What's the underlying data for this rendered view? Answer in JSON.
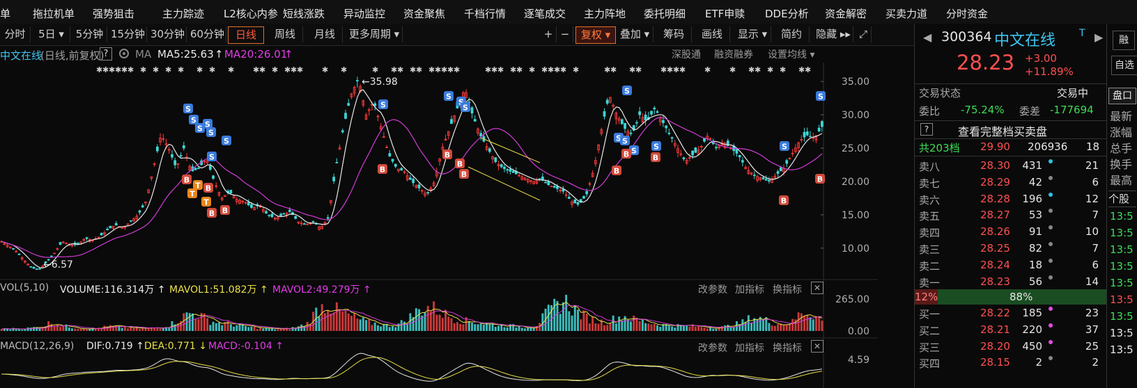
{
  "menu": [
    "单",
    "拖拉机单",
    "强势狙击",
    "主力踪迹",
    "L2核心内参",
    "短线涨跌",
    "异动监控",
    "资金聚焦",
    "千档行情",
    "逐笔成交",
    "主力阵地",
    "委托明细",
    "ETF申赎",
    "DDE分析",
    "资金解密",
    "买卖力道",
    "分时资金"
  ],
  "periods": [
    "分时",
    "5日 ▾",
    "5分钟",
    "15分钟",
    "30分钟",
    "60分钟",
    "日线",
    "周线",
    "月线",
    "更多周期 ▾"
  ],
  "tools": [
    "+",
    "−",
    "复权 ▾",
    "叠加 ▾",
    "筹码",
    "画线",
    "显示 ▾",
    "简约",
    "隐藏 ▸▸"
  ],
  "info": {
    "name": "中文在线",
    "mode": "(日线,前复权)",
    "help": "?",
    "ma_label": "MA",
    "ma5": "MA5:25.63",
    "ma20": "MA20:26.01",
    "links": [
      "深股通",
      "融资融券",
      "设置均线 ▾"
    ]
  },
  "chart_data": [
    {
      "type": "candlestick",
      "title": "中文在线 (日线,前复权)",
      "y_ticks": [
        "35.00",
        "30.00",
        "25.00",
        "20.00",
        "15.00",
        "10.00"
      ],
      "ylim": [
        5.5,
        37
      ],
      "annotations": [
        "←35.98",
        "←6.57"
      ],
      "series": [
        {
          "name": "MA5",
          "value": "25.63"
        },
        {
          "name": "MA20",
          "value": "26.01"
        }
      ],
      "close_path": [
        11,
        10.3,
        9.5,
        8.2,
        7.0,
        6.8,
        8.0,
        9.3,
        11.0,
        10.5,
        10.5,
        11.5,
        11.2,
        11.8,
        12.8,
        13.5,
        13.0,
        14.0,
        15.0,
        17.0,
        22.0,
        27.0,
        25.0,
        22.0,
        25.0,
        21.5,
        22.0,
        23.5,
        20.0,
        17.5,
        18.5,
        17.3,
        17.0,
        16.0,
        16.5,
        15.0,
        14.5,
        15.0,
        15.5,
        14.0,
        13.5,
        14.0,
        13.0,
        14.5,
        22.0,
        28.0,
        33.0,
        35.5,
        30.0,
        32.0,
        28.0,
        24.0,
        22.0,
        21.5,
        20.0,
        19.0,
        18.0,
        20.0,
        25.0,
        28.0,
        31.0,
        34.0,
        30.0,
        27.0,
        25.0,
        23.0,
        22.0,
        21.5,
        21.0,
        20.5,
        20.0,
        20.5,
        19.5,
        19.0,
        18.5,
        17.0,
        16.5,
        18.0,
        22.0,
        28.0,
        33.0,
        30.0,
        28.0,
        27.0,
        30.0,
        29.0,
        31.0,
        29.0,
        27.0,
        25.0,
        23.0,
        24.0,
        25.0,
        27.0,
        25.0,
        26.0,
        25.0,
        24.0,
        22.0,
        21.0,
        20.5,
        20.0,
        21.0,
        22.0,
        24.0,
        26.0,
        27.0,
        26.5,
        28.23
      ]
    },
    {
      "type": "bar",
      "title": "VOL(5,10)",
      "y_ticks": [
        "265.00",
        "0.00"
      ],
      "series": [
        {
          "name": "VOLUME",
          "value": "116.314万"
        },
        {
          "name": "MAVOL1",
          "value": "51.082万"
        },
        {
          "name": "MAVOL2",
          "value": "49.279万"
        }
      ],
      "vol_path": [
        5,
        6,
        5,
        8,
        10,
        22,
        14,
        10,
        7,
        6,
        8,
        12,
        10,
        8,
        6,
        7,
        9,
        15,
        30,
        45,
        40,
        26,
        20,
        18,
        14,
        10,
        8,
        6,
        5,
        6,
        10,
        20,
        55,
        68,
        50,
        40,
        30,
        22,
        18,
        14,
        15,
        28,
        48,
        60,
        54,
        40,
        30,
        25,
        22,
        18,
        15,
        14,
        12,
        10,
        12,
        40,
        62,
        75,
        52,
        36,
        26,
        22,
        30,
        38,
        28,
        24,
        18,
        15,
        14,
        13,
        12,
        10,
        9,
        10,
        15,
        22,
        35,
        30,
        20,
        18,
        22,
        50,
        44,
        26
      ]
    },
    {
      "type": "line",
      "title": "MACD(12,26,9)",
      "y_ticks": [
        "4.59"
      ],
      "series": [
        {
          "name": "DIF",
          "value": "0.719"
        },
        {
          "name": "DEA",
          "value": "0.771"
        },
        {
          "name": "MACD",
          "value": "-0.104"
        }
      ]
    }
  ],
  "vol_tools": [
    "改参数",
    "加指标",
    "换指标"
  ],
  "macd_tools": [
    "改参数",
    "加指标",
    "换指标"
  ],
  "quote": {
    "code": "300364",
    "name": "中文在线",
    "tag": "T",
    "price": "28.23",
    "change": "+3.00",
    "pct": "+11.89%",
    "status_label": "交易状态",
    "status": "交易中",
    "ratio_label": "委比",
    "ratio": "-75.24%",
    "diff_label": "委差",
    "diff": "-177694",
    "full_book": "查看完整档买卖盘",
    "levels_label": "共203档",
    "levels_price": "29.90",
    "levels_vol": "206936",
    "levels_cnt": "18"
  },
  "asks": [
    {
      "label": "卖八",
      "price": "28.30",
      "vol": "431",
      "cnt": "21",
      "dot": "#29c6e6"
    },
    {
      "label": "卖七",
      "price": "28.29",
      "vol": "42",
      "cnt": "6",
      "dot": "#888888"
    },
    {
      "label": "卖六",
      "price": "28.28",
      "vol": "196",
      "cnt": "12",
      "dot": "#29c6e6"
    },
    {
      "label": "卖五",
      "price": "28.27",
      "vol": "53",
      "cnt": "7",
      "dot": "#888888"
    },
    {
      "label": "卖四",
      "price": "28.26",
      "vol": "91",
      "cnt": "10",
      "dot": "#888888"
    },
    {
      "label": "卖三",
      "price": "28.25",
      "vol": "82",
      "cnt": "7",
      "dot": "#888888"
    },
    {
      "label": "卖二",
      "price": "28.24",
      "vol": "18",
      "cnt": "6",
      "dot": "#888888"
    },
    {
      "label": "卖一",
      "price": "28.23",
      "vol": "56",
      "cnt": "14",
      "dot": "#888888"
    }
  ],
  "depth": {
    "bid_pct": "12%",
    "ask_pct": "88%",
    "bid_fraction": 0.12
  },
  "bids": [
    {
      "label": "买一",
      "price": "28.22",
      "vol": "185",
      "cnt": "23",
      "dot": "#e64ce6"
    },
    {
      "label": "买二",
      "price": "28.21",
      "vol": "220",
      "cnt": "37",
      "dot": "#e64ce6"
    },
    {
      "label": "买三",
      "price": "28.20",
      "vol": "450",
      "cnt": "25",
      "dot": "#e64ce6"
    },
    {
      "label": "买四",
      "price": "28.15",
      "vol": "2",
      "cnt": "2",
      "dot": "#888888"
    }
  ],
  "side": {
    "tab": "盘口",
    "items": [
      "最新",
      "涨幅",
      "总手",
      "换手",
      "最高"
    ],
    "tab2": "个股",
    "times": [
      "13:5",
      "13:5",
      "13:5",
      "13:5",
      "13:5",
      "13:5",
      "13:5",
      "13:5",
      "13:5"
    ],
    "btn1": "融",
    "btn2": "自选"
  }
}
